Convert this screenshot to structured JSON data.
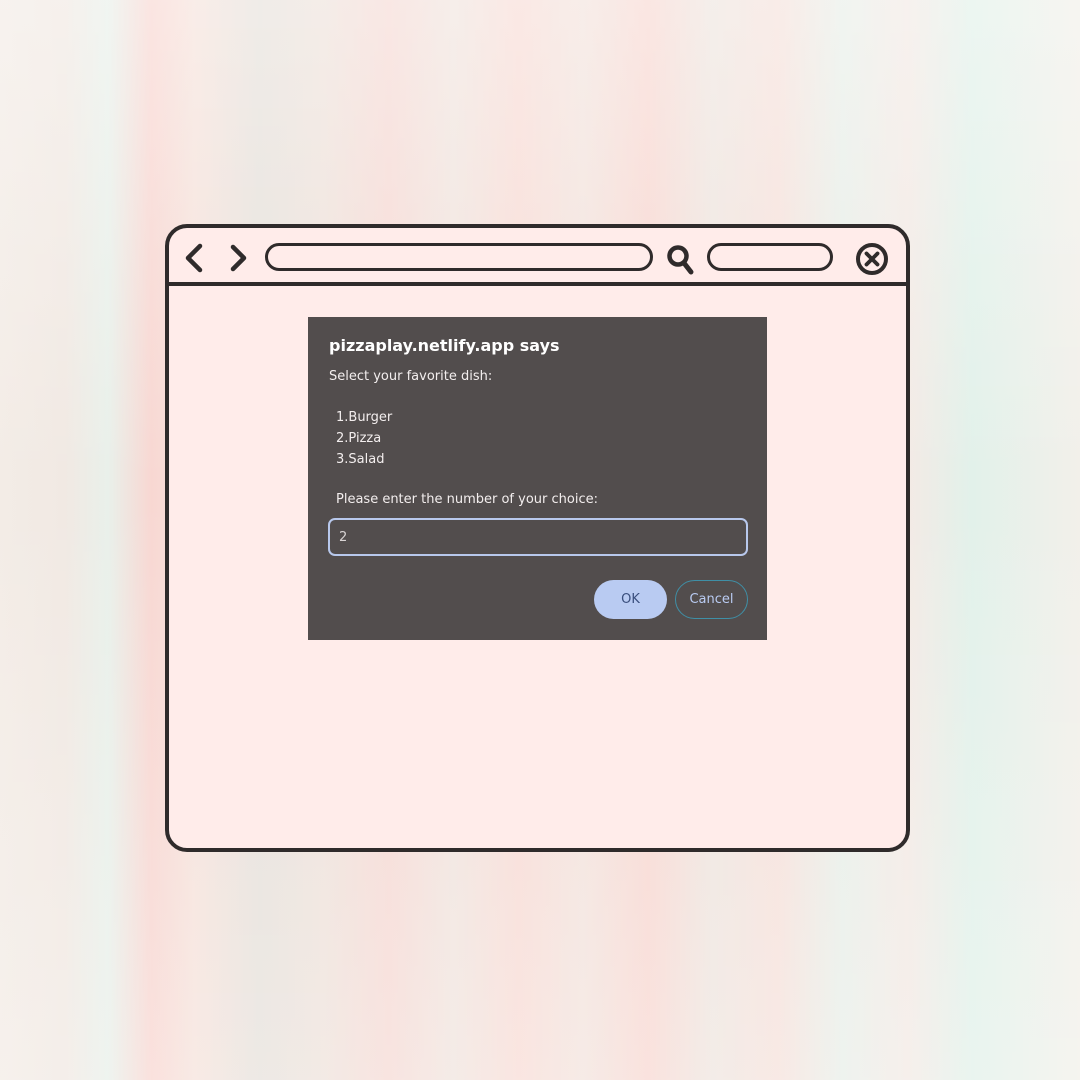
{
  "browser": {
    "icons": {
      "back": "chevron-left-icon",
      "forward": "chevron-right-icon",
      "search": "search-icon",
      "close": "close-icon"
    }
  },
  "dialog": {
    "title": "pizzaplay.netlify.app says",
    "prompt": "Select your favorite dish:",
    "options": [
      "1.Burger",
      "2.Pizza",
      "3.Salad"
    ],
    "instruction": "Please enter the number of your choice:",
    "input_value": "2",
    "ok_label": "OK",
    "cancel_label": "Cancel"
  },
  "colors": {
    "browser_bg": "#ffecea",
    "outline": "#2f2b2b",
    "dialog_bg": "#524d4d",
    "accent": "#b9cbf2"
  }
}
